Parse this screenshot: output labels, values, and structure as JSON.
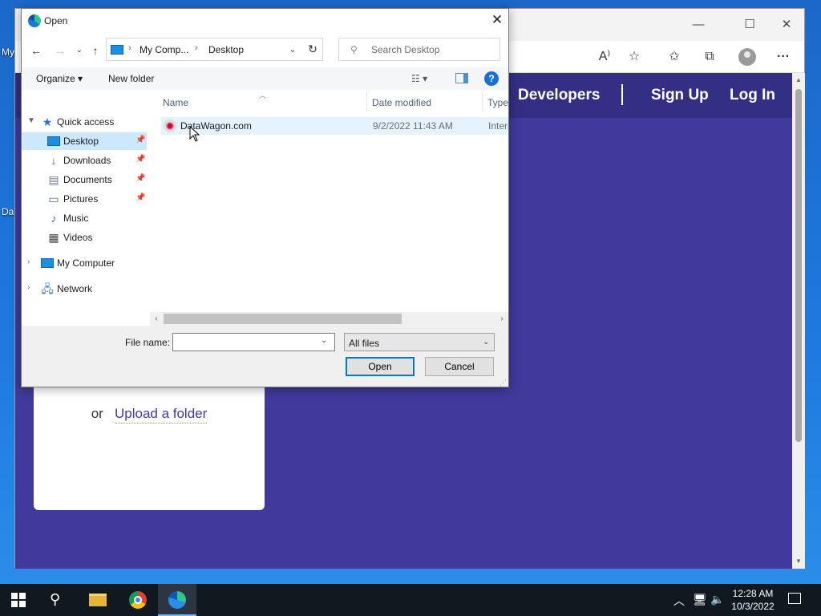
{
  "desktop": {
    "icon_labels": [
      "My",
      "Da"
    ]
  },
  "browser": {
    "controls": {
      "minimize": "—",
      "maximize": "☐",
      "close": "✕"
    },
    "toolbar_icons": [
      "read-aloud-icon",
      "add-favorite-icon",
      "favorites-icon",
      "collections-icon",
      "profile-icon",
      "more-icon"
    ],
    "read_aloud_glyph": "A⁾",
    "more_glyph": "···",
    "site": {
      "nav": {
        "developers": "Developers",
        "separator": "|",
        "signup": "Sign Up",
        "login": "Log In"
      },
      "upload": {
        "or": "or",
        "folder_link": "Upload a folder"
      }
    }
  },
  "dialog": {
    "title": "Open",
    "close": "✕",
    "nav": {
      "back": "←",
      "forward": "→",
      "recent": "⌄",
      "up": "↑"
    },
    "path": {
      "segments": [
        "My Comp...",
        "Desktop"
      ],
      "sep": "›"
    },
    "refresh": "↻",
    "search_placeholder": "Search Desktop",
    "commands": {
      "organize": "Organize ▾",
      "new_folder": "New folder",
      "view": "☷ ▾",
      "help": "?"
    },
    "nav_pane": {
      "quick_access": "Quick access",
      "quick_items": [
        {
          "label": "Desktop",
          "icon": "desktop-folder-icon",
          "pinned": true,
          "selected": true
        },
        {
          "label": "Downloads",
          "icon": "downloads-folder-icon",
          "pinned": true
        },
        {
          "label": "Documents",
          "icon": "documents-folder-icon",
          "pinned": true
        },
        {
          "label": "Pictures",
          "icon": "pictures-folder-icon",
          "pinned": true
        },
        {
          "label": "Music",
          "icon": "music-folder-icon"
        },
        {
          "label": "Videos",
          "icon": "videos-folder-icon"
        }
      ],
      "my_computer": "My Computer",
      "network": "Network"
    },
    "columns": {
      "name": "Name",
      "date": "Date modified",
      "type": "Type"
    },
    "files": [
      {
        "name": "DataWagon.com",
        "date": "9/2/2022 11:43 AM",
        "type": "Intern"
      }
    ],
    "file_name_label": "File name:",
    "file_name_value": "",
    "file_filter": "All files",
    "open_button": "Open",
    "cancel_button": "Cancel"
  },
  "taskbar": {
    "clock_time": "12:28 AM",
    "clock_date": "10/3/2022",
    "tray_icons": [
      "chevron-up-icon",
      "network-icon",
      "volume-icon",
      "notification-icon"
    ]
  }
}
